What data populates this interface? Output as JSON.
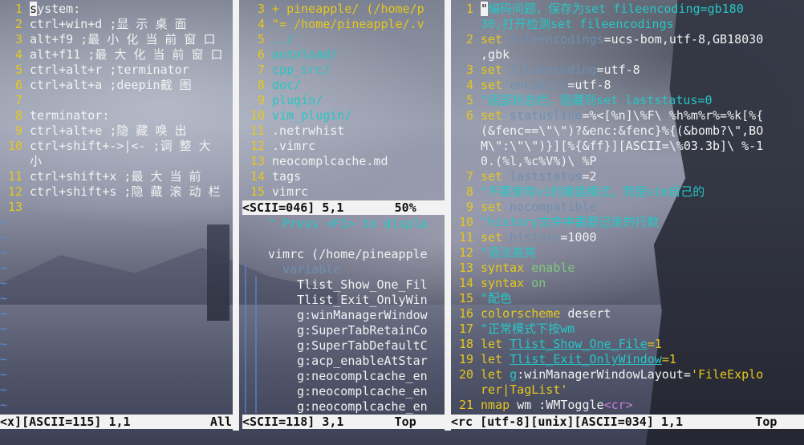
{
  "left": {
    "lines": [
      {
        "n": "1",
        "text": "system:"
      },
      {
        "n": "2",
        "text": "ctrl+win+d ;显 示 桌 面"
      },
      {
        "n": "3",
        "text": "alt+f9 ;最 小 化 当 前 窗 口"
      },
      {
        "n": "4",
        "text": "alt+f11 ;最 大 化 当 前 窗 口"
      },
      {
        "n": "5",
        "text": "ctrl+alt+r ;terminator"
      },
      {
        "n": "6",
        "text": "ctrl+alt+a ;deepin截 图"
      },
      {
        "n": "7",
        "text": ""
      },
      {
        "n": "8",
        "text": "terminator:"
      },
      {
        "n": "9",
        "text": "ctrl+alt+e ;隐 藏 唤 出"
      },
      {
        "n": "10",
        "text": "ctrl+shift+->|<- ;调 整 大"
      },
      {
        "n": "",
        "text": "小"
      },
      {
        "n": "11",
        "text": "ctrl+shift+x ;最 大 当 前"
      },
      {
        "n": "12",
        "text": "ctrl+shift+s ;隐 藏 滚 动 栏"
      },
      {
        "n": "13",
        "text": ""
      }
    ],
    "tilde": "~",
    "status": "<x][ASCII=115] 1,1           All"
  },
  "mid_top": {
    "lines": [
      {
        "n": "3",
        "text": "+ pineapple/ (/home/p",
        "cls": "kw"
      },
      {
        "n": "4",
        "text": "\"= /home/pineapple/.v",
        "cls": "kw"
      },
      {
        "n": "5",
        "text": "../",
        "cls": "dir"
      },
      {
        "n": "6",
        "text": "autoload/",
        "cls": "dir"
      },
      {
        "n": "7",
        "text": "cpp_src/",
        "cls": "dir"
      },
      {
        "n": "8",
        "text": "doc/",
        "cls": "dir"
      },
      {
        "n": "9",
        "text": "plugin/",
        "cls": "dir"
      },
      {
        "n": "10",
        "text": "vim_plugin/",
        "cls": "dir"
      },
      {
        "n": "11",
        "text": ".netrwhist",
        "cls": "txt"
      },
      {
        "n": "12",
        "text": ".vimrc",
        "cls": "txt"
      },
      {
        "n": "13",
        "text": "neocomplcache.md",
        "cls": "txt"
      },
      {
        "n": "14",
        "text": "tags",
        "cls": "txt"
      },
      {
        "n": "15",
        "text": "vimrc",
        "cls": "txt"
      }
    ],
    "status": "<SCII=046] 5,1       50%"
  },
  "mid_bottom": {
    "lines": [
      {
        "text": "\" Press <F1> to displa",
        "cls": "cmt"
      },
      {
        "text": "",
        "cls": "txt"
      },
      {
        "text": "vimrc (/home/pineapple",
        "cls": "txt"
      },
      {
        "text": "  variable",
        "cls": "dim"
      },
      {
        "text": "    Tlist_Show_One_Fil",
        "cls": "txt"
      },
      {
        "text": "    Tlist_Exit_OnlyWin",
        "cls": "txt"
      },
      {
        "text": "    g:winManagerWindow",
        "cls": "txt"
      },
      {
        "text": "    g:SuperTabRetainCo",
        "cls": "txt"
      },
      {
        "text": "    g:SuperTabDefaultC",
        "cls": "txt"
      },
      {
        "text": "    g:acp_enableAtStar",
        "cls": "txt"
      },
      {
        "text": "    g:neocomplcache_en",
        "cls": "txt"
      },
      {
        "text": "    g:neocomplcache_en",
        "cls": "txt"
      },
      {
        "text": "    g:neocomplcache_en",
        "cls": "txt"
      }
    ],
    "status": "<SCII=118] 3,1       Top"
  },
  "right": {
    "lines": [
      {
        "n": "1",
        "parts": [
          {
            "t": "\"编码问题，保存为set fileencoding=gb180",
            "c": "cmt"
          }
        ]
      },
      {
        "n": "",
        "parts": [
          {
            "t": "30,打开检测set fileencodings",
            "c": "cmt"
          }
        ]
      },
      {
        "n": "2",
        "parts": [
          {
            "t": "set ",
            "c": "kw"
          },
          {
            "t": "fileencodings",
            "c": "dim"
          },
          {
            "t": "=ucs-bom,utf-8,GB18030",
            "c": "txt"
          }
        ]
      },
      {
        "n": "",
        "parts": [
          {
            "t": ",gbk",
            "c": "txt"
          }
        ]
      },
      {
        "n": "3",
        "parts": [
          {
            "t": "set ",
            "c": "kw"
          },
          {
            "t": "fileencoding",
            "c": "dim"
          },
          {
            "t": "=utf-8",
            "c": "txt"
          }
        ]
      },
      {
        "n": "4",
        "parts": [
          {
            "t": "set ",
            "c": "kw"
          },
          {
            "t": "encoding",
            "c": "dim"
          },
          {
            "t": "=utf-8",
            "c": "txt"
          }
        ]
      },
      {
        "n": "5",
        "parts": [
          {
            "t": "\"底部状态栏，隐藏则set laststatus=0",
            "c": "cmt"
          }
        ]
      },
      {
        "n": "6",
        "parts": [
          {
            "t": "set ",
            "c": "kw"
          },
          {
            "t": "statusline",
            "c": "dim"
          },
          {
            "t": "=%<[%n]\\%F\\ %h%m%r%=%k[%{",
            "c": "txt"
          }
        ]
      },
      {
        "n": "",
        "parts": [
          {
            "t": "(&fenc==\\\"\\\")?&enc:&fenc}%{(&bomb?\\\",BO",
            "c": "txt"
          }
        ]
      },
      {
        "n": "",
        "parts": [
          {
            "t": "M\\\":\\\"\\\")}][%{&ff}][ASCII=\\%03.3b]\\ %-1",
            "c": "txt"
          }
        ]
      },
      {
        "n": "",
        "parts": [
          {
            "t": "0.(%l,%c%V%)\\ %P",
            "c": "txt"
          }
        ]
      },
      {
        "n": "7",
        "parts": [
          {
            "t": "set ",
            "c": "kw"
          },
          {
            "t": "laststatus",
            "c": "dim"
          },
          {
            "t": "=2",
            "c": "txt"
          }
        ]
      },
      {
        "n": "8",
        "parts": [
          {
            "t": "\"不要使用vi的键盘模式，而是vim自己的",
            "c": "cmt"
          }
        ]
      },
      {
        "n": "9",
        "parts": [
          {
            "t": "set ",
            "c": "kw"
          },
          {
            "t": "nocompatible",
            "c": "dim"
          }
        ]
      },
      {
        "n": "10",
        "parts": [
          {
            "t": "\"history文件中需要记录的行数",
            "c": "cmt"
          }
        ]
      },
      {
        "n": "11",
        "parts": [
          {
            "t": "set ",
            "c": "kw"
          },
          {
            "t": "history",
            "c": "dim"
          },
          {
            "t": "=1000",
            "c": "txt"
          }
        ]
      },
      {
        "n": "12",
        "parts": [
          {
            "t": "\"语法高亮",
            "c": "cmt"
          }
        ]
      },
      {
        "n": "13",
        "parts": [
          {
            "t": "syntax ",
            "c": "kw"
          },
          {
            "t": "enable",
            "c": "grn"
          }
        ]
      },
      {
        "n": "14",
        "parts": [
          {
            "t": "syntax ",
            "c": "kw"
          },
          {
            "t": "on",
            "c": "grn"
          }
        ]
      },
      {
        "n": "15",
        "parts": [
          {
            "t": "\"配色",
            "c": "cmt"
          }
        ]
      },
      {
        "n": "16",
        "parts": [
          {
            "t": "colorscheme ",
            "c": "kw"
          },
          {
            "t": "desert",
            "c": "txt"
          }
        ]
      },
      {
        "n": "17",
        "parts": [
          {
            "t": "\"正常模式下按wm",
            "c": "cmt"
          }
        ]
      },
      {
        "n": "18",
        "parts": [
          {
            "t": "let ",
            "c": "kw"
          },
          {
            "t": "Tlist_Show_One_File",
            "c": "cmtu"
          },
          {
            "t": "=1",
            "c": "kw"
          }
        ]
      },
      {
        "n": "19",
        "parts": [
          {
            "t": "let ",
            "c": "kw"
          },
          {
            "t": "Tlist_Exit_OnlyWindow",
            "c": "cmtu"
          },
          {
            "t": "=1",
            "c": "kw"
          }
        ]
      },
      {
        "n": "20",
        "parts": [
          {
            "t": "let ",
            "c": "kw"
          },
          {
            "t": "g",
            "c": "cmt"
          },
          {
            "t": ":winManagerWindowLayout=",
            "c": "txt"
          },
          {
            "t": "'FileExplo",
            "c": "kw"
          }
        ]
      },
      {
        "n": "",
        "parts": [
          {
            "t": "rer|TagList'",
            "c": "kw"
          }
        ]
      },
      {
        "n": "21",
        "parts": [
          {
            "t": "nmap ",
            "c": "kw"
          },
          {
            "t": "wm :WMToggle",
            "c": "txt"
          },
          {
            "t": "<cr>",
            "c": "pur"
          }
        ]
      }
    ],
    "status": "<rc [utf-8][unix][ASCII=034] 1,1          Top"
  },
  "colors": {
    "line_number": "#e5c71d",
    "comment": "#26c6c6",
    "keyword": "#e5c71d",
    "text": "#f2f2f2",
    "tilde": "#5b8bd8",
    "status_bg": "#f2f2f2"
  }
}
